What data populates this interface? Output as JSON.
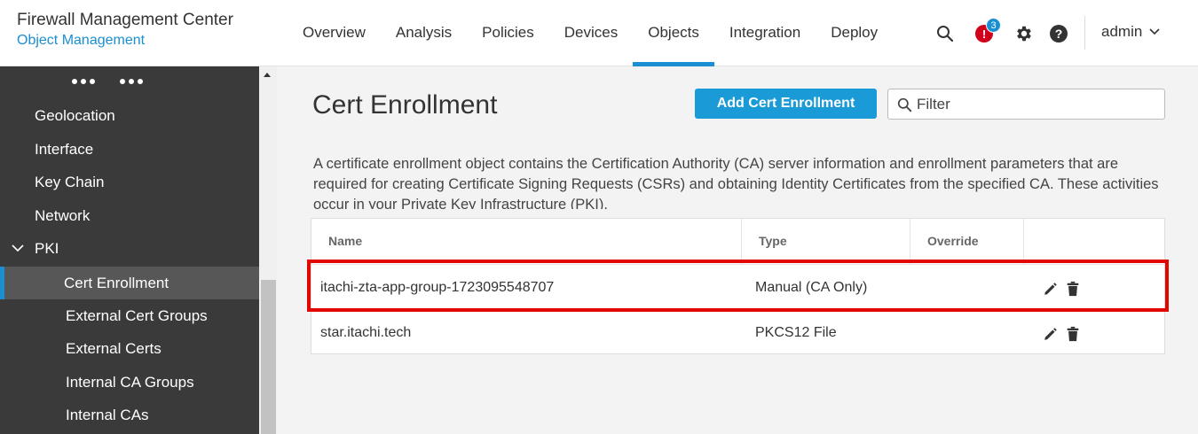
{
  "app": {
    "title": "Firewall Management Center",
    "subtitle": "Object Management"
  },
  "nav": {
    "items": [
      "Overview",
      "Analysis",
      "Policies",
      "Devices",
      "Objects",
      "Integration",
      "Deploy"
    ],
    "active": "Objects"
  },
  "header": {
    "alert_count": "3",
    "alert_symbol": "!",
    "help_symbol": "?",
    "user": "admin",
    "accent_color": "#1a8fd1",
    "alert_color": "#d0021b"
  },
  "sidebar": {
    "items": [
      {
        "label": "Geolocation"
      },
      {
        "label": "Interface"
      },
      {
        "label": "Key Chain"
      },
      {
        "label": "Network"
      },
      {
        "label": "PKI",
        "expanded": true
      },
      {
        "label": "Cert Enrollment",
        "active": true
      },
      {
        "label": "External Cert Groups"
      },
      {
        "label": "External Certs"
      },
      {
        "label": "Internal CA Groups"
      },
      {
        "label": "Internal CAs"
      }
    ]
  },
  "main": {
    "title": "Cert Enrollment",
    "add_button": "Add Cert Enrollment",
    "filter_placeholder": "Filter",
    "description": "A certificate enrollment object contains the Certification Authority (CA) server information and enrollment parameters that are required for creating Certificate Signing Requests (CSRs) and obtaining Identity Certificates from the specified CA. These activities occur in your Private Key Infrastructure (PKI).",
    "table": {
      "columns": [
        "Name",
        "Type",
        "Override",
        ""
      ],
      "rows": [
        {
          "name": "itachi-zta-app-group-1723095548707",
          "type": "Manual (CA Only)",
          "override": "",
          "highlighted": true
        },
        {
          "name": "star.itachi.tech",
          "type": "PKCS12 File",
          "override": ""
        }
      ]
    },
    "highlight_color": "#e10600"
  }
}
